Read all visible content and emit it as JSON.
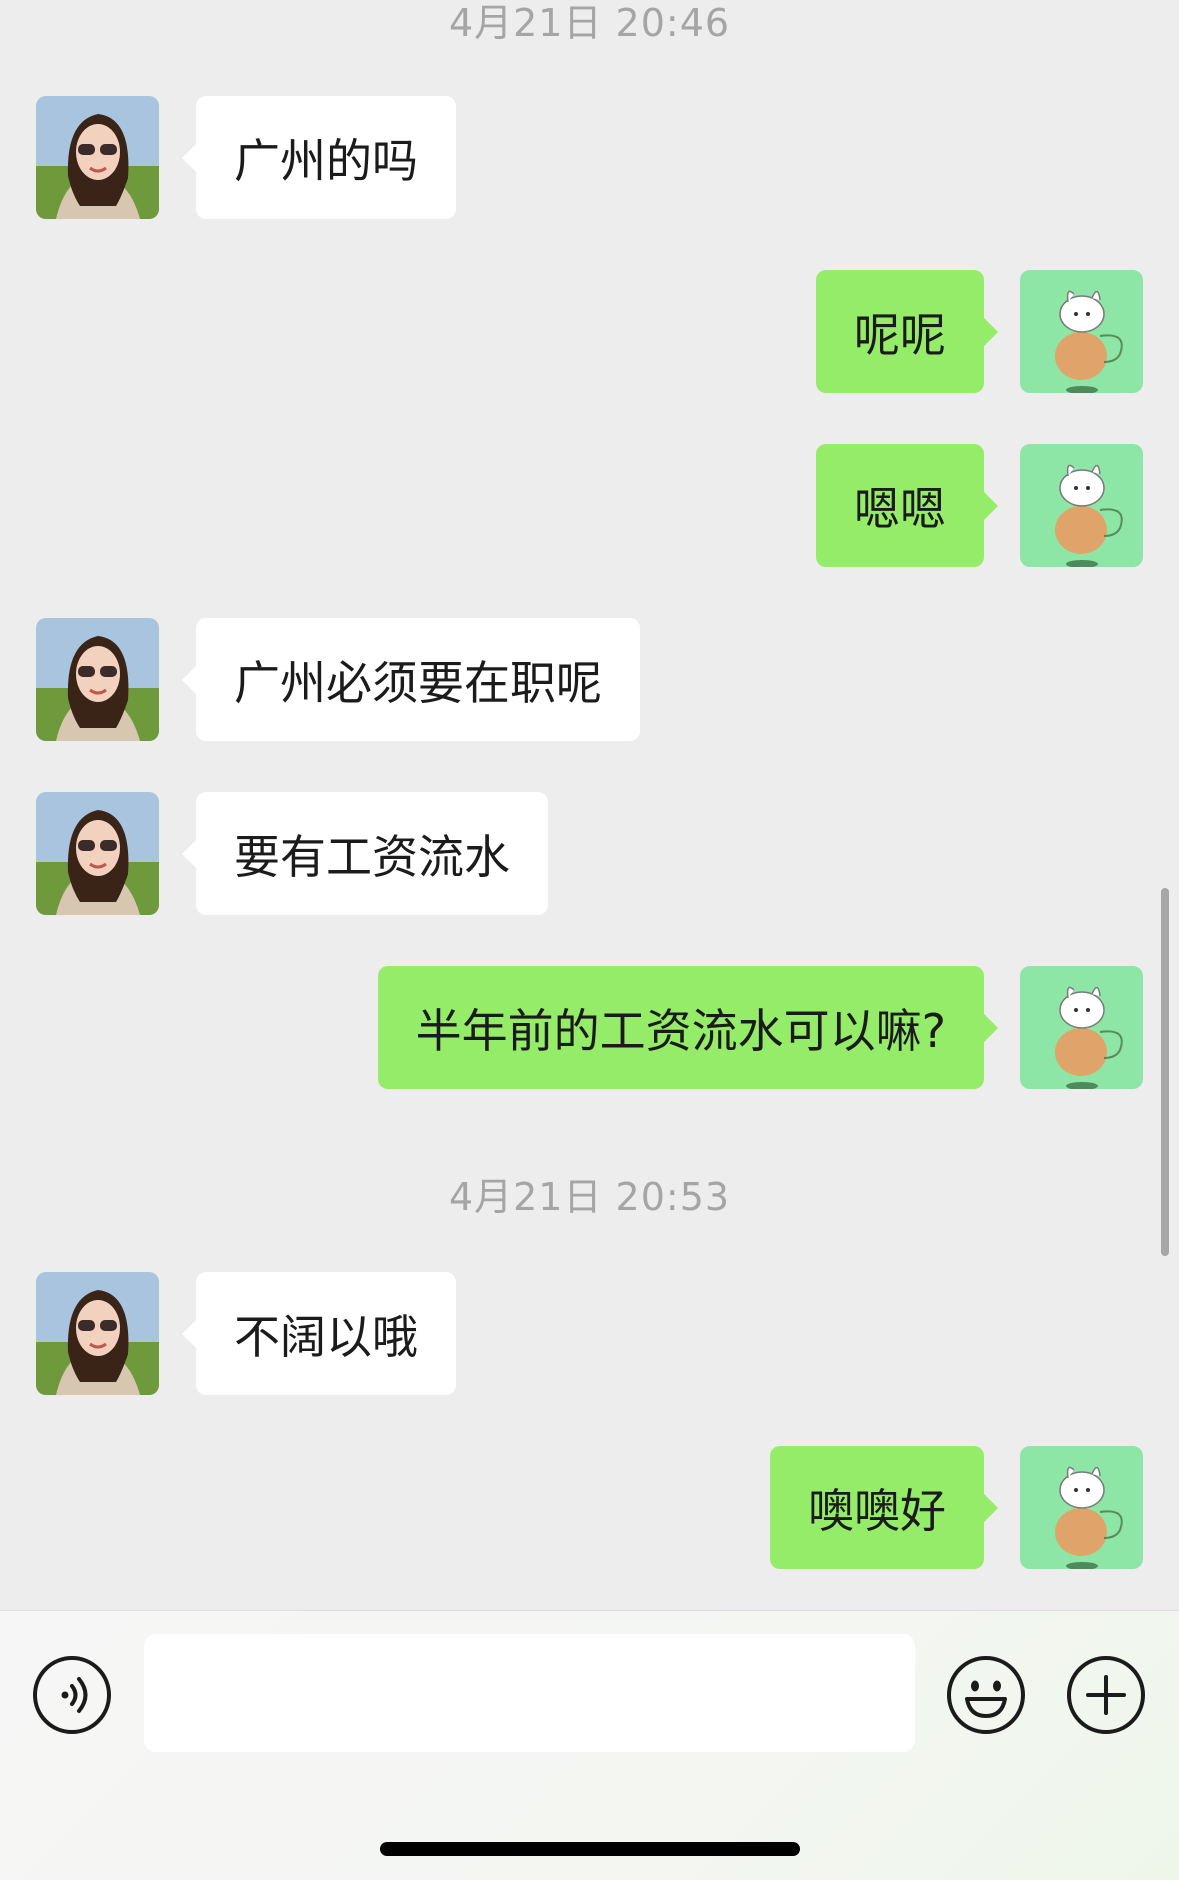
{
  "chat": {
    "timestamps": [
      "4月21日 20:46",
      "4月21日 20:53"
    ],
    "messages": [
      {
        "side": "in",
        "text": "广州的吗"
      },
      {
        "side": "out",
        "text": "呢呢"
      },
      {
        "side": "out",
        "text": "嗯嗯"
      },
      {
        "side": "in",
        "text": "广州必须要在职呢"
      },
      {
        "side": "in",
        "text": "要有工资流水"
      },
      {
        "side": "out",
        "text": "半年前的工资流水可以嘛?"
      },
      {
        "side": "in",
        "text": "不阔以哦"
      },
      {
        "side": "out",
        "text": "噢噢好"
      }
    ]
  },
  "input_bar": {
    "message_input_value": "",
    "voice_icon": "voice-icon",
    "emoji_icon": "emoji-icon",
    "plus_icon": "plus-icon"
  },
  "colors": {
    "background": "#ededed",
    "incoming_bubble": "#ffffff",
    "outgoing_bubble": "#95ec69",
    "timestamp": "#a5a5a5"
  }
}
